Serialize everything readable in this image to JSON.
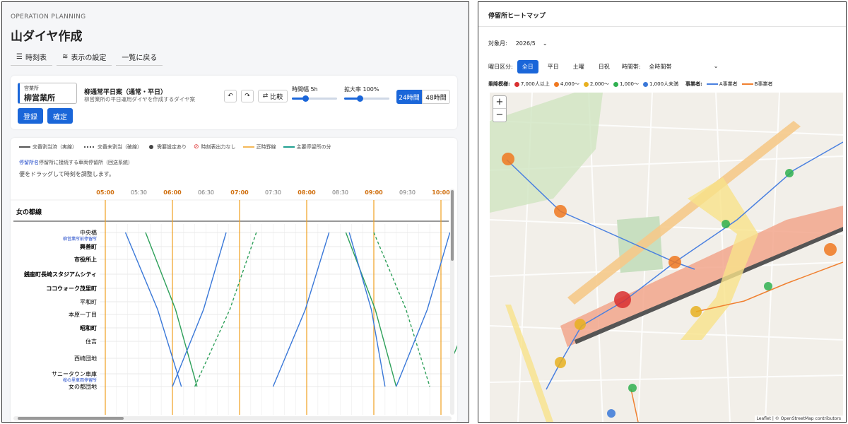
{
  "left": {
    "eyebrow": "OPERATION PLANNING",
    "title": "山ダイヤ作成",
    "toolbar": [
      {
        "label": "時刻表",
        "icon": "list-icon"
      },
      {
        "label": "表示の設定",
        "icon": "settings-icon"
      },
      {
        "label": "一覧に戻る",
        "icon": ""
      }
    ],
    "office": {
      "label": "営業所",
      "value": "柳営業所"
    },
    "register_label": "登録",
    "confirm_label": "確定",
    "plan_name": "柳通常平日案（通常・平日）",
    "plan_desc": "柳営業所の平日運用ダイヤを作成するダイヤ案",
    "compare_label": "比較",
    "time_width": {
      "label": "時間幅 5h",
      "value": 0.3
    },
    "zoom": {
      "label": "拡大率 100%",
      "value": 0.35
    },
    "range_24": "24時間",
    "range_48": "48時間",
    "legend": [
      "交番割当済（実線）",
      "交番未割当（破線）",
      "需要設定あり",
      "時刻表出力なし",
      "正時罫線",
      "主要停留所の分"
    ],
    "help_prefix": "停留所名",
    "help_text": "停留所に接続する車両停留所（回送系統）",
    "drag_hint": "便をドラッグして時刻を調整します。",
    "time_labels": [
      "05:00",
      "05:30",
      "06:00",
      "06:30",
      "07:00",
      "07:30",
      "08:00",
      "08:30",
      "09:00",
      "09:30",
      "10:00"
    ],
    "route_name": "女の都線",
    "stops": [
      {
        "name": "中央橋",
        "sub": "柳営業所前停留所",
        "bold": false
      },
      {
        "name": "興善町",
        "sub": "",
        "bold": true
      },
      {
        "name": "市役所上",
        "sub": "",
        "bold": true
      },
      {
        "name": "銭座町長崎スタジアムシティ",
        "sub": "",
        "bold": true
      },
      {
        "name": "ココウォーク茂里町",
        "sub": "",
        "bold": true
      },
      {
        "name": "平和町",
        "sub": "",
        "bold": false
      },
      {
        "name": "本原一丁目",
        "sub": "",
        "bold": false
      },
      {
        "name": "昭和町",
        "sub": "",
        "bold": true
      },
      {
        "name": "住吉",
        "sub": "",
        "bold": false
      },
      {
        "name": "西崎団地",
        "sub": "",
        "bold": false
      },
      {
        "name": "サニータウン車庫",
        "sub": "桜の里車両停留所",
        "bold": false
      },
      {
        "name": "女の都団地",
        "sub": "",
        "bold": false
      }
    ],
    "colors": {
      "blue": "#3a78d8",
      "green": "#2ea05a",
      "hour": "#f0a020",
      "accent": "#1a66d9"
    }
  },
  "right": {
    "title": "停留所ヒートマップ",
    "month_label": "対象月:",
    "month_value": "2026/5",
    "daytype_label": "曜日区分:",
    "daytypes": [
      "全日",
      "平日",
      "土曜",
      "日祝"
    ],
    "timeband_label": "時間帯:",
    "timeband_value": "全時間帯",
    "riders_label": "乗降模様:",
    "rider_levels": [
      {
        "label": "7,000人以上",
        "color": "#d93030"
      },
      {
        "label": "4,000〜",
        "color": "#f07820"
      },
      {
        "label": "2,000〜",
        "color": "#e8b020"
      },
      {
        "label": "1,000〜",
        "color": "#30b050"
      },
      {
        "label": "1,000人未満",
        "color": "#3a78d8"
      }
    ],
    "operator_label": "事業者:",
    "operators": [
      {
        "label": "A事業者",
        "color": "#4a80e0"
      },
      {
        "label": "B事業者",
        "color": "#f08030"
      }
    ],
    "zoom_in": "+",
    "zoom_out": "−",
    "attribution": "Leaflet | © OpenStreetMap contributors"
  }
}
